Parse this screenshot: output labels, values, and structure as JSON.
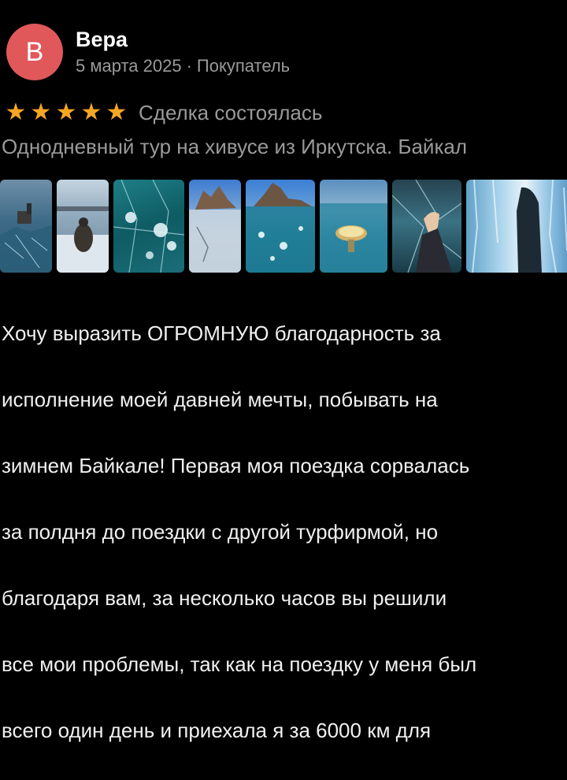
{
  "review": {
    "avatar_letter": "В",
    "avatar_color": "#e0585a",
    "author_name": "Вера",
    "date": "5 марта 2025",
    "separator": "·",
    "role": "Покупатель",
    "rating": 5,
    "star_color": "#f5a623",
    "deal_status": "Сделка состоялась",
    "tour_title": "Однодневный тур на хивусе из Иркутска. Байкал",
    "photos": [
      {
        "name": "photo-hovercraft-on-ice"
      },
      {
        "name": "photo-person-on-ice"
      },
      {
        "name": "photo-ice-bubbles"
      },
      {
        "name": "photo-rock-on-ice"
      },
      {
        "name": "photo-shamanka-rock"
      },
      {
        "name": "photo-cup-on-ice"
      },
      {
        "name": "photo-hand-over-ice"
      },
      {
        "name": "photo-ice-cave"
      }
    ],
    "text_lines": [
      "Хочу выразить ОГРОМНУЮ благодарность за",
      "исполнение моей давней мечты, побывать на",
      "зимнем Байкале! Первая моя поездка сорвалась",
      "за полдня до поездки с другой турфирмой, но",
      "благодаря вам, за несколько часов вы решили",
      "все мои проблемы, так как на поездку у меня был",
      "всего один день и приехала я за 6000 км для"
    ]
  }
}
